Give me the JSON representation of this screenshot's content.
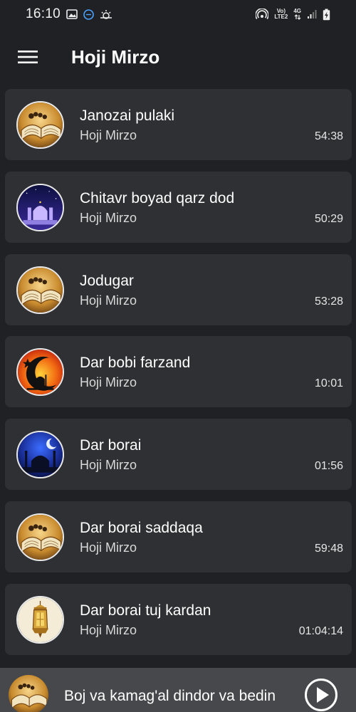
{
  "status_bar": {
    "time": "16:10",
    "net_top": "Vo)",
    "net_bottom": "LTE2",
    "net_type": "4G"
  },
  "app_bar": {
    "title": "Hoji Mirzo",
    "menu_icon": "hamburger-menu-icon"
  },
  "tracks": [
    {
      "title": "Janozai pulaki",
      "artist": "Hoji Mirzo",
      "duration": "54:38",
      "art": "quran-book"
    },
    {
      "title": "Chitavr boyad qarz dod",
      "artist": "Hoji Mirzo",
      "duration": "50:29",
      "art": "mosque-night"
    },
    {
      "title": "Jodugar",
      "artist": "Hoji Mirzo",
      "duration": "53:28",
      "art": "quran-book"
    },
    {
      "title": "Dar bobi farzand",
      "artist": "Hoji Mirzo",
      "duration": "10:01",
      "art": "crescent-sunset"
    },
    {
      "title": "Dar borai",
      "artist": "Hoji Mirzo",
      "duration": "01:56",
      "art": "mosque-blue"
    },
    {
      "title": "Dar borai saddaqa",
      "artist": "Hoji Mirzo",
      "duration": "59:48",
      "art": "quran-book"
    },
    {
      "title": "Dar borai tuj kardan",
      "artist": "Hoji Mirzo",
      "duration": "01:04:14",
      "art": "lantern"
    }
  ],
  "mini_player": {
    "title": "Boj va kamag'al dindor va bedin",
    "art": "quran-book",
    "play_icon": "play-icon"
  },
  "colors": {
    "background": "#202124",
    "card": "#2f3033",
    "mini_player": "#46484c"
  }
}
